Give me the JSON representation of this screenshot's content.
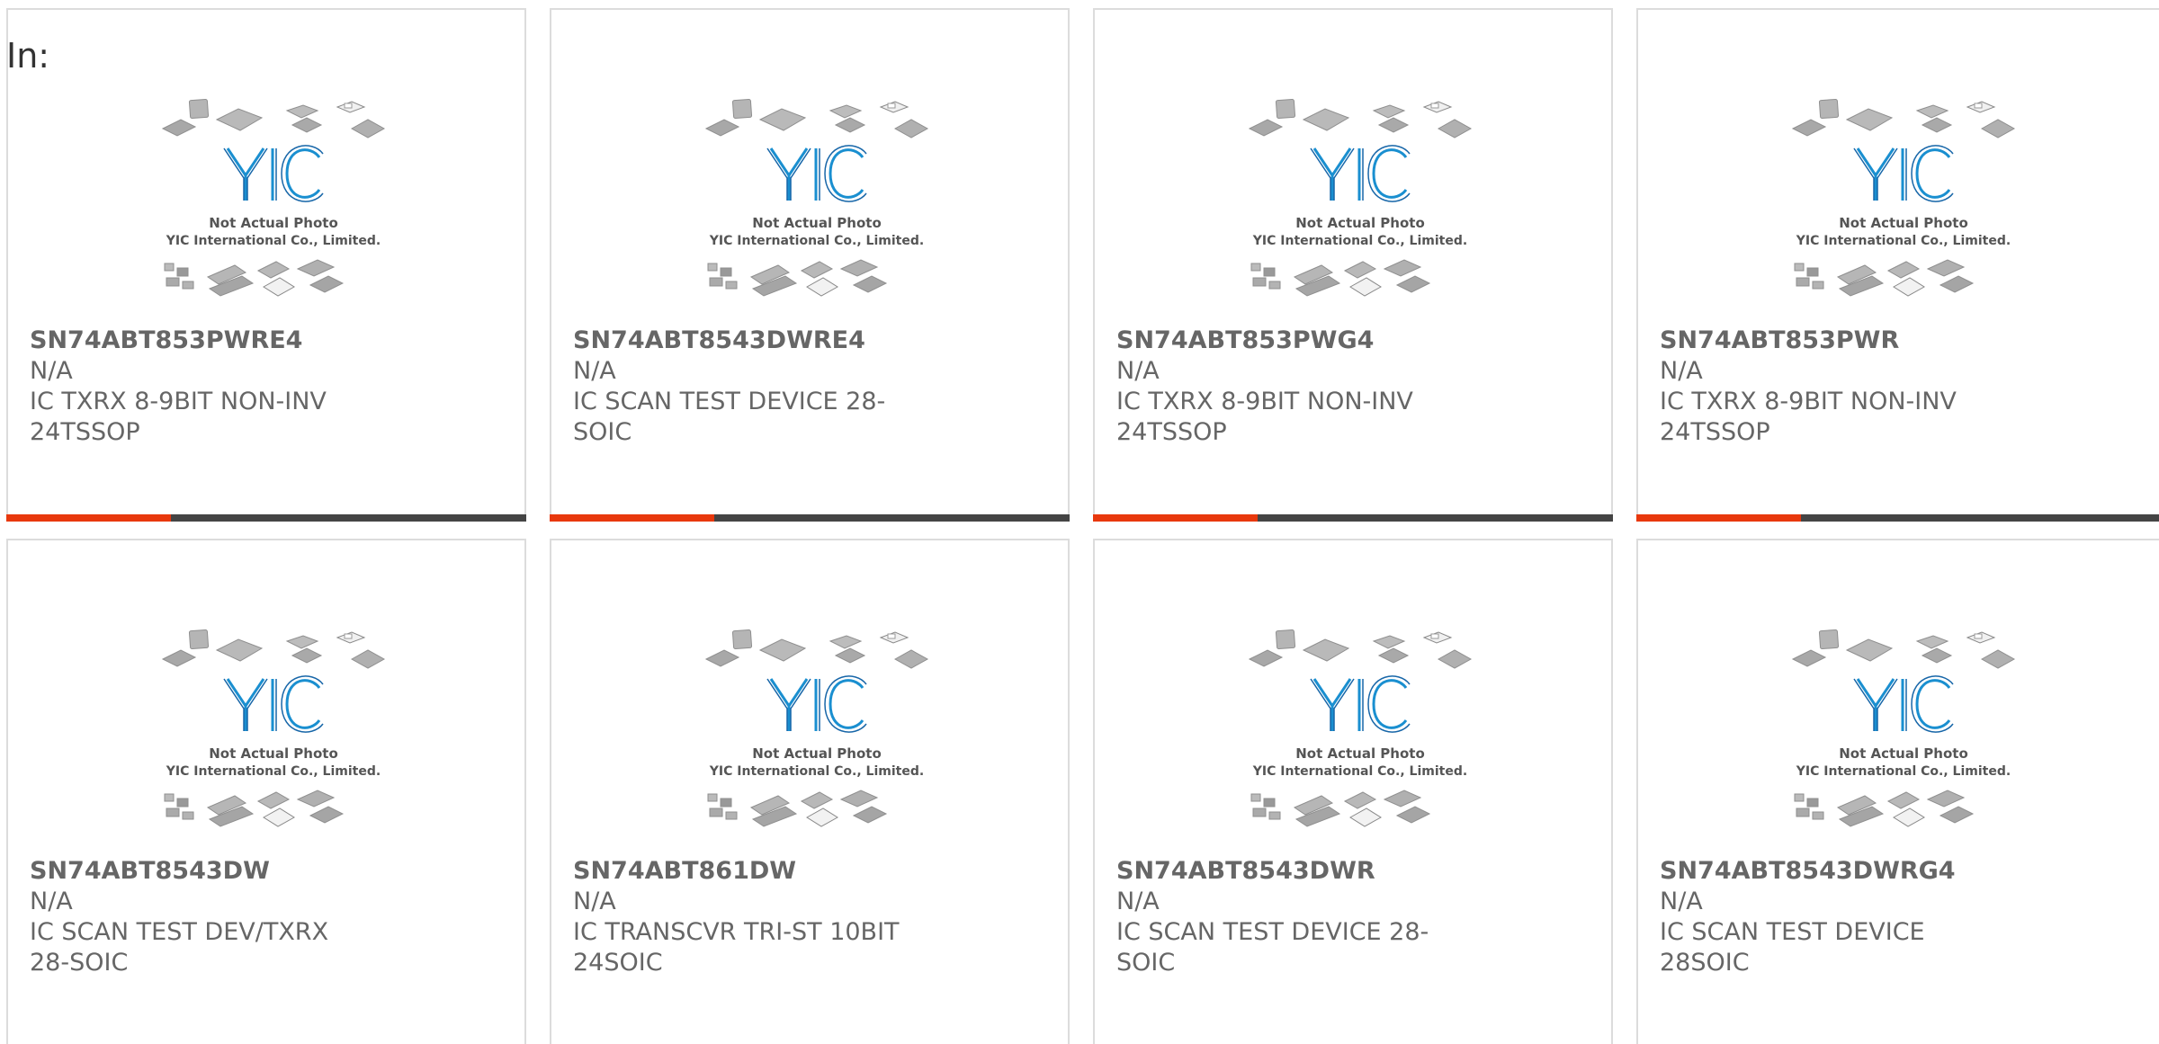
{
  "header": {
    "in_label": "In:"
  },
  "photo": {
    "caption_line1": "Not Actual Photo",
    "caption_line2": "YIC International Co., Limited.",
    "logo_text": "YIC"
  },
  "products": [
    {
      "part_number": "SN74ABT853PWRE4",
      "manufacturer": "N/A",
      "description": "IC TXRX 8-9BIT NON-INV 24TSSOP"
    },
    {
      "part_number": "SN74ABT8543DWRE4",
      "manufacturer": "N/A",
      "description": "IC SCAN TEST DEVICE 28-SOIC"
    },
    {
      "part_number": "SN74ABT853PWG4",
      "manufacturer": "N/A",
      "description": "IC TXRX 8-9BIT NON-INV 24TSSOP"
    },
    {
      "part_number": "SN74ABT853PWR",
      "manufacturer": "N/A",
      "description": "IC TXRX 8-9BIT NON-INV 24TSSOP"
    },
    {
      "part_number": "SN74ABT8543DW",
      "manufacturer": "N/A",
      "description": "IC SCAN TEST DEV/TXRX 28-SOIC"
    },
    {
      "part_number": "SN74ABT861DW",
      "manufacturer": "N/A",
      "description": "IC TRANSCVR TRI-ST 10BIT 24SOIC"
    },
    {
      "part_number": "SN74ABT8543DWR",
      "manufacturer": "N/A",
      "description": "IC SCAN TEST DEVICE 28-SOIC"
    },
    {
      "part_number": "SN74ABT8543DWRG4",
      "manufacturer": "N/A",
      "description": "IC SCAN TEST DEVICE 28SOIC"
    }
  ],
  "colors": {
    "accent": "#e8380d",
    "bar": "#444444",
    "logo_blue": "#1a8fd0",
    "chip_gray": "#a8a8a8"
  }
}
